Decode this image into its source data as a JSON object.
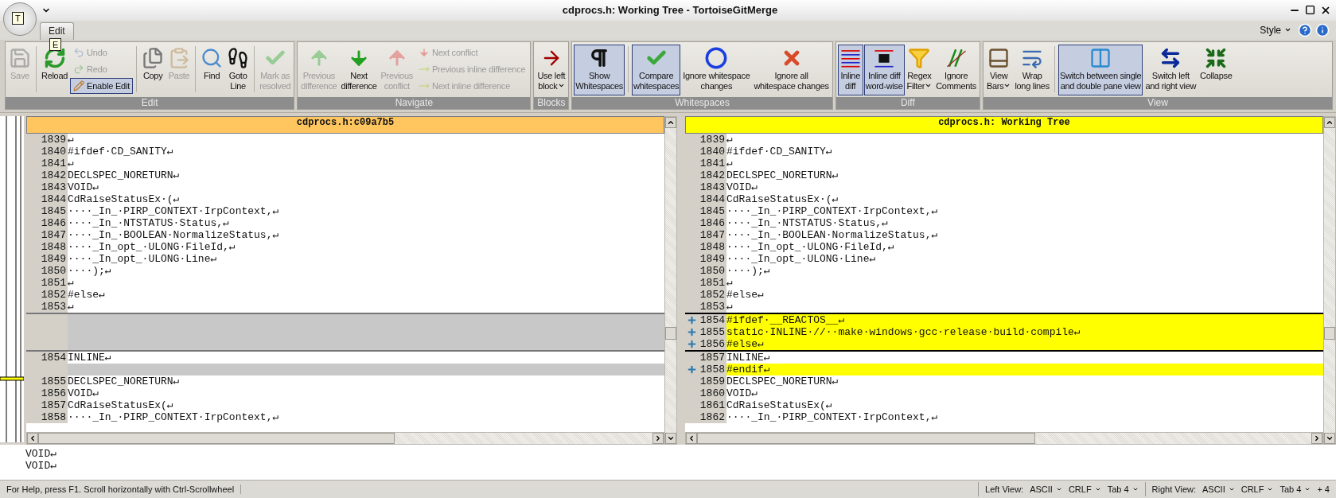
{
  "app_menu": {
    "keytip": "T"
  },
  "window": {
    "title": "cdprocs.h: Working Tree - TortoiseGitMerge"
  },
  "tabs": [
    {
      "label": "Edit",
      "selected": true,
      "keytip": "E"
    }
  ],
  "style_menu": {
    "label": "Style"
  },
  "ribbon": {
    "groups": [
      {
        "label": "Edit",
        "items": [
          {
            "kind": "large",
            "label": "Save",
            "disabled": true,
            "selected": false
          },
          {
            "kind": "separator"
          },
          {
            "kind": "large",
            "label": "Reload",
            "disabled": false,
            "selected": false
          },
          {
            "kind": "stack",
            "items": [
              {
                "label": "Undo",
                "disabled": true,
                "selected": false
              },
              {
                "label": "Redo",
                "disabled": true,
                "selected": false
              },
              {
                "label": "Enable Edit",
                "disabled": false,
                "selected": true
              }
            ]
          },
          {
            "kind": "separator"
          },
          {
            "kind": "large",
            "label": "Copy",
            "disabled": false,
            "selected": false
          },
          {
            "kind": "large",
            "label": "Paste",
            "disabled": true,
            "selected": false
          },
          {
            "kind": "separator"
          },
          {
            "kind": "large",
            "label": "Find",
            "disabled": false,
            "selected": false
          },
          {
            "kind": "large",
            "label": "Goto\nLine",
            "disabled": false,
            "selected": false
          },
          {
            "kind": "separator"
          },
          {
            "kind": "large",
            "label": "Mark as\nresolved",
            "disabled": true,
            "selected": false
          }
        ]
      },
      {
        "label": "Navigate",
        "items": [
          {
            "kind": "large",
            "label": "Previous\ndifference",
            "disabled": true,
            "selected": false
          },
          {
            "kind": "large",
            "label": "Next\ndifference",
            "disabled": false,
            "selected": false
          },
          {
            "kind": "large",
            "label": "Previous\nconflict",
            "disabled": true,
            "selected": false
          },
          {
            "kind": "stack",
            "items": [
              {
                "label": "Next conflict",
                "disabled": true,
                "selected": false
              },
              {
                "label": "Previous inline difference",
                "disabled": true,
                "selected": false
              },
              {
                "label": "Next inline difference",
                "disabled": true,
                "selected": false
              }
            ]
          }
        ]
      },
      {
        "label": "Blocks",
        "items": [
          {
            "kind": "large",
            "label": "Use left\nblock",
            "disabled": false,
            "selected": false,
            "dropdown": true
          }
        ]
      },
      {
        "label": "Whitespaces",
        "items": [
          {
            "kind": "large",
            "label": "Show\nWhitespaces",
            "disabled": false,
            "selected": true
          },
          {
            "kind": "separator"
          },
          {
            "kind": "large",
            "label": "Compare\nwhitespaces",
            "disabled": false,
            "selected": true
          },
          {
            "kind": "large",
            "label": "Ignore whitespace\nchanges",
            "disabled": false,
            "selected": false
          },
          {
            "kind": "large",
            "label": "Ignore all\nwhitespace changes",
            "disabled": false,
            "selected": false
          }
        ]
      },
      {
        "label": "Diff",
        "items": [
          {
            "kind": "large",
            "label": "Inline\ndiff",
            "disabled": false,
            "selected": true
          },
          {
            "kind": "large",
            "label": "Inline diff\nword-wise",
            "disabled": false,
            "selected": true
          },
          {
            "kind": "large",
            "label": "Regex\nFilter",
            "disabled": false,
            "selected": false,
            "dropdown": true
          },
          {
            "kind": "large",
            "label": "Ignore\nComments",
            "disabled": false,
            "selected": false
          }
        ]
      },
      {
        "label": "View",
        "items": [
          {
            "kind": "large",
            "label": "View\nBars",
            "disabled": false,
            "selected": false,
            "dropdown": true
          },
          {
            "kind": "large",
            "label": "Wrap\nlong lines",
            "disabled": false,
            "selected": false
          },
          {
            "kind": "separator"
          },
          {
            "kind": "large",
            "label": "Switch between single\nand double pane view",
            "disabled": false,
            "selected": true
          },
          {
            "kind": "large",
            "label": "Switch left\nand right view",
            "disabled": false,
            "selected": false
          },
          {
            "kind": "large",
            "label": "Collapse",
            "disabled": false,
            "selected": false
          }
        ]
      }
    ]
  },
  "panes": [
    {
      "title": "cdprocs.h:c09a7b5",
      "kind": "base",
      "lines": [
        {
          "kind": "normal",
          "number": "1839",
          "text": "↵"
        },
        {
          "kind": "normal",
          "number": "1840",
          "text": "#ifdef·CD_SANITY↵"
        },
        {
          "kind": "normal",
          "number": "1841",
          "text": "↵"
        },
        {
          "kind": "normal",
          "number": "1842",
          "text": "DECLSPEC_NORETURN↵"
        },
        {
          "kind": "normal",
          "number": "1843",
          "text": "VOID↵"
        },
        {
          "kind": "normal",
          "number": "1844",
          "text": "CdRaiseStatusEx·(↵"
        },
        {
          "kind": "normal",
          "number": "1845",
          "text": "····_In_·PIRP_CONTEXT·IrpContext,↵"
        },
        {
          "kind": "normal",
          "number": "1846",
          "text": "····_In_·NTSTATUS·Status,↵"
        },
        {
          "kind": "normal",
          "number": "1847",
          "text": "····_In_·BOOLEAN·NormalizeStatus,↵"
        },
        {
          "kind": "normal",
          "number": "1848",
          "text": "····_In_opt_·ULONG·FileId,↵"
        },
        {
          "kind": "normal",
          "number": "1849",
          "text": "····_In_opt_·ULONG·Line↵"
        },
        {
          "kind": "normal",
          "number": "1850",
          "text": "····);↵"
        },
        {
          "kind": "normal",
          "number": "1851",
          "text": "↵"
        },
        {
          "kind": "normal",
          "number": "1852",
          "text": "#else↵"
        },
        {
          "kind": "normal",
          "number": "1853",
          "text": "↵"
        },
        {
          "kind": "empty"
        },
        {
          "kind": "empty"
        },
        {
          "kind": "empty"
        },
        {
          "kind": "normal",
          "number": "1854",
          "text": "INLINE↵"
        },
        {
          "kind": "empty"
        },
        {
          "kind": "normal",
          "number": "1855",
          "text": "DECLSPEC_NORETURN↵"
        },
        {
          "kind": "normal",
          "number": "1856",
          "text": "VOID↵"
        },
        {
          "kind": "normal",
          "number": "1857",
          "text": "CdRaiseStatusEx(↵"
        },
        {
          "kind": "normal",
          "number": "1858",
          "text": "····_In_·PIRP_CONTEXT·IrpContext,↵"
        }
      ]
    },
    {
      "title": "cdprocs.h: Working Tree",
      "kind": "working",
      "lines": [
        {
          "kind": "normal",
          "number": "1839",
          "text": "↵"
        },
        {
          "kind": "normal",
          "number": "1840",
          "text": "#ifdef·CD_SANITY↵"
        },
        {
          "kind": "normal",
          "number": "1841",
          "text": "↵"
        },
        {
          "kind": "normal",
          "number": "1842",
          "text": "DECLSPEC_NORETURN↵"
        },
        {
          "kind": "normal",
          "number": "1843",
          "text": "VOID↵"
        },
        {
          "kind": "normal",
          "number": "1844",
          "text": "CdRaiseStatusEx·(↵"
        },
        {
          "kind": "normal",
          "number": "1845",
          "text": "····_In_·PIRP_CONTEXT·IrpContext,↵"
        },
        {
          "kind": "normal",
          "number": "1846",
          "text": "····_In_·NTSTATUS·Status,↵"
        },
        {
          "kind": "normal",
          "number": "1847",
          "text": "····_In_·BOOLEAN·NormalizeStatus,↵"
        },
        {
          "kind": "normal",
          "number": "1848",
          "text": "····_In_opt_·ULONG·FileId,↵"
        },
        {
          "kind": "normal",
          "number": "1849",
          "text": "····_In_opt_·ULONG·Line↵"
        },
        {
          "kind": "normal",
          "number": "1850",
          "text": "····);↵"
        },
        {
          "kind": "normal",
          "number": "1851",
          "text": "↵"
        },
        {
          "kind": "normal",
          "number": "1852",
          "text": "#else↵"
        },
        {
          "kind": "normal",
          "number": "1853",
          "text": "↵"
        },
        {
          "kind": "added",
          "number": "1854",
          "text": "#ifdef·__REACTOS__↵"
        },
        {
          "kind": "added",
          "number": "1855",
          "text": "static·INLINE·//··make·windows·gcc·release·build·compile↵"
        },
        {
          "kind": "added",
          "number": "1856",
          "text": "#else↵"
        },
        {
          "kind": "normal",
          "number": "1857",
          "text": "INLINE↵"
        },
        {
          "kind": "added",
          "number": "1858",
          "text": "#endif↵"
        },
        {
          "kind": "normal",
          "number": "1859",
          "text": "DECLSPEC_NORETURN↵"
        },
        {
          "kind": "normal",
          "number": "1860",
          "text": "VOID↵"
        },
        {
          "kind": "normal",
          "number": "1861",
          "text": "CdRaiseStatusEx(↵"
        },
        {
          "kind": "normal",
          "number": "1862",
          "text": "····_In_·PIRP_CONTEXT·IrpContext,↵"
        }
      ]
    }
  ],
  "detail_lines": [
    "VOID↵",
    "VOID↵"
  ],
  "status_bar": {
    "help": "For Help, press F1. Scroll horizontally with Ctrl-Scrollwheel",
    "views": [
      {
        "label": "Left View:",
        "encoding": "ASCII",
        "eol": "CRLF",
        "tab": "Tab 4"
      },
      {
        "label": "Right View:",
        "encoding": "ASCII",
        "eol": "CRLF",
        "tab": "Tab 4",
        "extra": "+ 4"
      }
    ]
  }
}
